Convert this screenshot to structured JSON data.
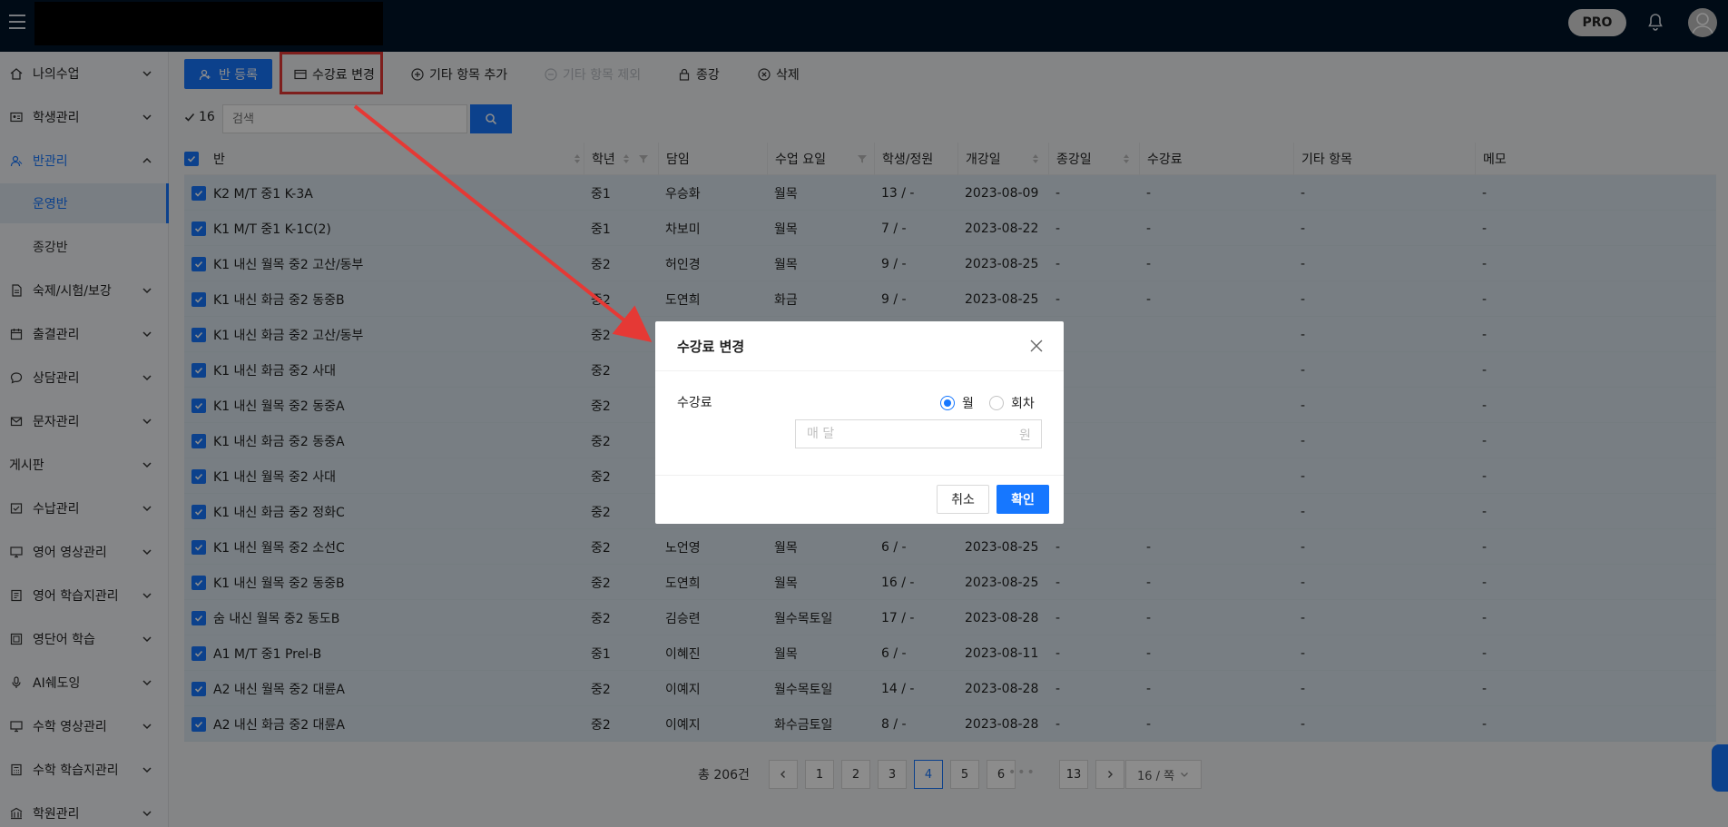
{
  "header": {
    "pro_label": "PRO",
    "menu_icon": "hamburger-icon",
    "bell_icon": "bell-icon",
    "avatar_icon": "user-avatar-icon"
  },
  "sidebar": {
    "items": [
      {
        "label": "나의수업",
        "icon": "home-icon"
      },
      {
        "label": "학생관리",
        "icon": "id-card-icon"
      },
      {
        "label": "반관리",
        "icon": "users-icon",
        "active": true
      },
      {
        "label": "숙제/시험/보강",
        "icon": "document-icon"
      },
      {
        "label": "출결관리",
        "icon": "calendar-icon"
      },
      {
        "label": "상담관리",
        "icon": "chat-icon"
      },
      {
        "label": "문자관리",
        "icon": "mail-icon"
      },
      {
        "label": "게시판",
        "icon": ""
      },
      {
        "label": "수납관리",
        "icon": "payment-icon"
      },
      {
        "label": "영어 영상관리",
        "icon": "monitor-icon"
      },
      {
        "label": "영어 학습지관리",
        "icon": "book-icon"
      },
      {
        "label": "영단어 학습",
        "icon": "vocab-icon"
      },
      {
        "label": "AI쉐도잉",
        "icon": "microphone-icon"
      },
      {
        "label": "수학 영상관리",
        "icon": "monitor-icon"
      },
      {
        "label": "수학 학습지관리",
        "icon": "calculator-icon"
      },
      {
        "label": "학원관리",
        "icon": "building-icon"
      }
    ],
    "sub_items": [
      {
        "label": "운영반",
        "active": true
      },
      {
        "label": "종강반",
        "active": false
      }
    ]
  },
  "toolbar": {
    "register_class": "반 등록",
    "change_fee": "수강료 변경",
    "add_other_item": "기타 항목 추가",
    "remove_other_item": "기타 항목 제외",
    "end_class": "종강",
    "delete": "삭제"
  },
  "search": {
    "selected_count": "16",
    "placeholder": "검색"
  },
  "table": {
    "columns": [
      "반",
      "학년",
      "담임",
      "수업 요일",
      "학생/정원",
      "개강일",
      "종강일",
      "수강료",
      "기타 항목",
      "메모"
    ],
    "rows": [
      {
        "class": "K2 M/T 중1 K-3A",
        "grade": "중1",
        "teacher": "우승화",
        "days": "월목",
        "students": "13 / -",
        "start": "2023-08-09",
        "end": "-",
        "fee": "-",
        "other": "-",
        "memo": "-"
      },
      {
        "class": "K1 M/T 중1 K-1C(2)",
        "grade": "중1",
        "teacher": "차보미",
        "days": "월목",
        "students": "7 / -",
        "start": "2023-08-22",
        "end": "-",
        "fee": "-",
        "other": "-",
        "memo": "-"
      },
      {
        "class": "K1 내신 월목 중2 고산/동부",
        "grade": "중2",
        "teacher": "허인경",
        "days": "월목",
        "students": "9 / -",
        "start": "2023-08-25",
        "end": "-",
        "fee": "-",
        "other": "-",
        "memo": "-"
      },
      {
        "class": "K1 내신 화금 중2 동중B",
        "grade": "중2",
        "teacher": "도연희",
        "days": "화금",
        "students": "9 / -",
        "start": "2023-08-25",
        "end": "-",
        "fee": "-",
        "other": "-",
        "memo": "-"
      },
      {
        "class": "K1 내신 화금 중2 고산/동부",
        "grade": "중2",
        "teacher": "",
        "days": "",
        "students": "",
        "start": "",
        "end": "",
        "fee": "",
        "other": "-",
        "memo": "-"
      },
      {
        "class": "K1 내신 화금 중2 사대",
        "grade": "중2",
        "teacher": "",
        "days": "",
        "students": "",
        "start": "",
        "end": "",
        "fee": "",
        "other": "-",
        "memo": "-"
      },
      {
        "class": "K1 내신 월목 중2 동중A",
        "grade": "중2",
        "teacher": "",
        "days": "",
        "students": "",
        "start": "",
        "end": "",
        "fee": "",
        "other": "-",
        "memo": "-"
      },
      {
        "class": "K1 내신 화금 중2 동중A",
        "grade": "중2",
        "teacher": "",
        "days": "",
        "students": "",
        "start": "",
        "end": "",
        "fee": "",
        "other": "-",
        "memo": "-"
      },
      {
        "class": "K1 내신 월목 중2 사대",
        "grade": "중2",
        "teacher": "",
        "days": "",
        "students": "",
        "start": "",
        "end": "",
        "fee": "",
        "other": "-",
        "memo": "-"
      },
      {
        "class": "K1 내신 화금 중2 정화C",
        "grade": "중2",
        "teacher": "",
        "days": "",
        "students": "",
        "start": "",
        "end": "",
        "fee": "",
        "other": "-",
        "memo": "-"
      },
      {
        "class": "K1 내신 월목 중2 소선C",
        "grade": "중2",
        "teacher": "노언영",
        "days": "월목",
        "students": "6 / -",
        "start": "2023-08-25",
        "end": "-",
        "fee": "-",
        "other": "-",
        "memo": "-"
      },
      {
        "class": "K1 내신 월목 중2 동중B",
        "grade": "중2",
        "teacher": "도연희",
        "days": "월목",
        "students": "16 / -",
        "start": "2023-08-25",
        "end": "-",
        "fee": "-",
        "other": "-",
        "memo": "-"
      },
      {
        "class": "숨 내신 월목 중2 동도B",
        "grade": "중2",
        "teacher": "김승련",
        "days": "월수목토일",
        "students": "17 / -",
        "start": "2023-08-28",
        "end": "-",
        "fee": "-",
        "other": "-",
        "memo": "-"
      },
      {
        "class": "A1 M/T 중1 Prel-B",
        "grade": "중1",
        "teacher": "이혜진",
        "days": "월목",
        "students": "6 / -",
        "start": "2023-08-11",
        "end": "-",
        "fee": "-",
        "other": "-",
        "memo": "-"
      },
      {
        "class": "A2 내신 월목 중2 대륜A",
        "grade": "중2",
        "teacher": "이예지",
        "days": "월수목토일",
        "students": "14 / -",
        "start": "2023-08-28",
        "end": "-",
        "fee": "-",
        "other": "-",
        "memo": "-"
      },
      {
        "class": "A2 내신 화금 중2 대륜A",
        "grade": "중2",
        "teacher": "이예지",
        "days": "화수금토일",
        "students": "8 / -",
        "start": "2023-08-28",
        "end": "-",
        "fee": "-",
        "other": "-",
        "memo": "-"
      }
    ]
  },
  "pagination": {
    "total": "총 206건",
    "pages": [
      "1",
      "2",
      "3",
      "4",
      "5",
      "6",
      "13"
    ],
    "current": "4",
    "dots": "•••",
    "page_size": "16 / 쪽"
  },
  "modal": {
    "title": "수강료 변경",
    "fee_label": "수강료",
    "option_monthly": "월",
    "option_per_session": "회차",
    "input_placeholder": "매 달",
    "input_suffix": "원",
    "cancel": "취소",
    "confirm": "확인"
  },
  "colors": {
    "primary": "#1677ff",
    "header_bg": "#001529",
    "annotation_red": "#e53935",
    "row_selected_bg": "#dae6ee"
  }
}
